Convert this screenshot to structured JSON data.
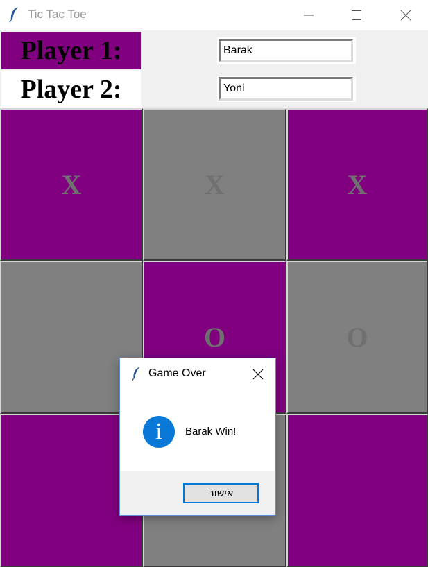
{
  "window": {
    "title": "Tic Tac Toe",
    "controls": [
      "minimize-icon",
      "maximize-icon",
      "close-icon"
    ]
  },
  "players": {
    "player1_label": "Player 1:",
    "player2_label": "Player 2:",
    "player1_name": "Barak",
    "player2_name": "Yoni"
  },
  "board": {
    "cells": [
      "X",
      "X",
      "X",
      "",
      "O",
      "O",
      "",
      "",
      ""
    ],
    "colors": {
      "purple": "#800080",
      "gray": "#808080",
      "mark": "#707070"
    }
  },
  "dialog": {
    "title": "Game Over",
    "icon": "info-icon",
    "message": "Barak Win!",
    "ok_label": "אישור",
    "accent": "#0078d7"
  }
}
